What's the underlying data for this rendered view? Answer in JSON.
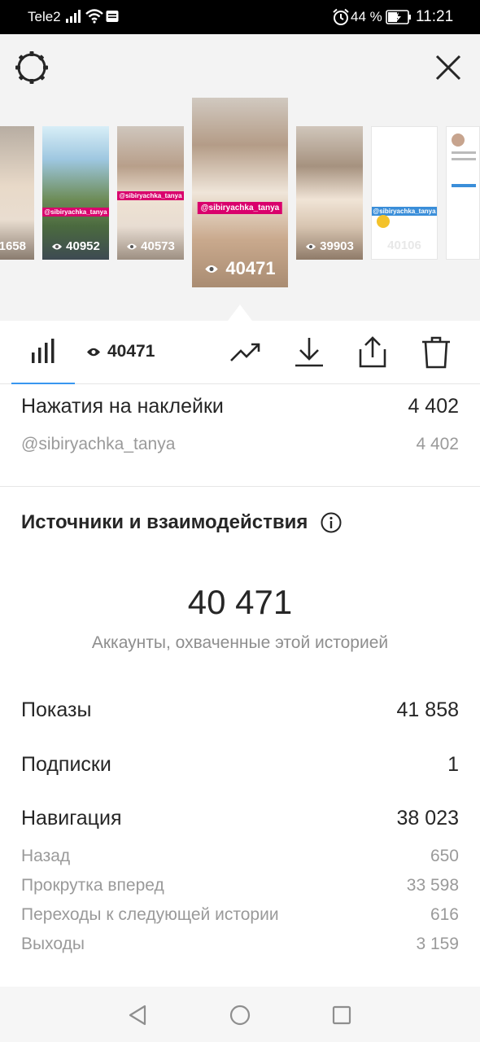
{
  "status_bar": {
    "carrier": "Tele2",
    "battery_percent": "44 %",
    "time": "11:21",
    "icons": [
      "signal-icon",
      "wifi-icon",
      "message-icon",
      "alarm-icon",
      "battery-charging-icon"
    ]
  },
  "thumbnails": [
    {
      "views": "1658",
      "tag": ""
    },
    {
      "views": "40952",
      "tag": "@sibiryachka_tanya"
    },
    {
      "views": "40573",
      "tag": "@sibiryachka_tanya"
    },
    {
      "views": "40471",
      "tag": "@sibiryachka_tanya",
      "selected": true
    },
    {
      "views": "39903",
      "tag": ""
    },
    {
      "views": "40106",
      "tag": "@sibiryachka_tanya"
    },
    {
      "views": "",
      "tag": ""
    }
  ],
  "toolbar": {
    "views": "40471",
    "icons": [
      "bar-chart-icon",
      "eye-icon",
      "trending-up-icon",
      "download-icon",
      "share-icon",
      "trash-icon"
    ]
  },
  "sticker_taps": {
    "label": "Нажатия на наклейки",
    "value": "4 402",
    "items": [
      {
        "label": "@sibiryachka_tanya",
        "value": "4 402"
      }
    ]
  },
  "discovery": {
    "title": "Источники и взаимодействия",
    "reach_value": "40 471",
    "reach_label": "Аккаунты, охваченные этой историей",
    "impressions": {
      "label": "Показы",
      "value": "41 858"
    },
    "follows": {
      "label": "Подписки",
      "value": "1"
    },
    "navigation": {
      "label": "Навигация",
      "value": "38 023",
      "items": [
        {
          "label": "Назад",
          "value": "650"
        },
        {
          "label": "Прокрутка вперед",
          "value": "33 598"
        },
        {
          "label": "Переходы к следующей истории",
          "value": "616"
        },
        {
          "label": "Выходы",
          "value": "3 159"
        }
      ]
    }
  },
  "colors": {
    "accent": "#3897f0",
    "text": "#262626",
    "muted": "#9a9a9a",
    "tag": "#d9006c"
  }
}
